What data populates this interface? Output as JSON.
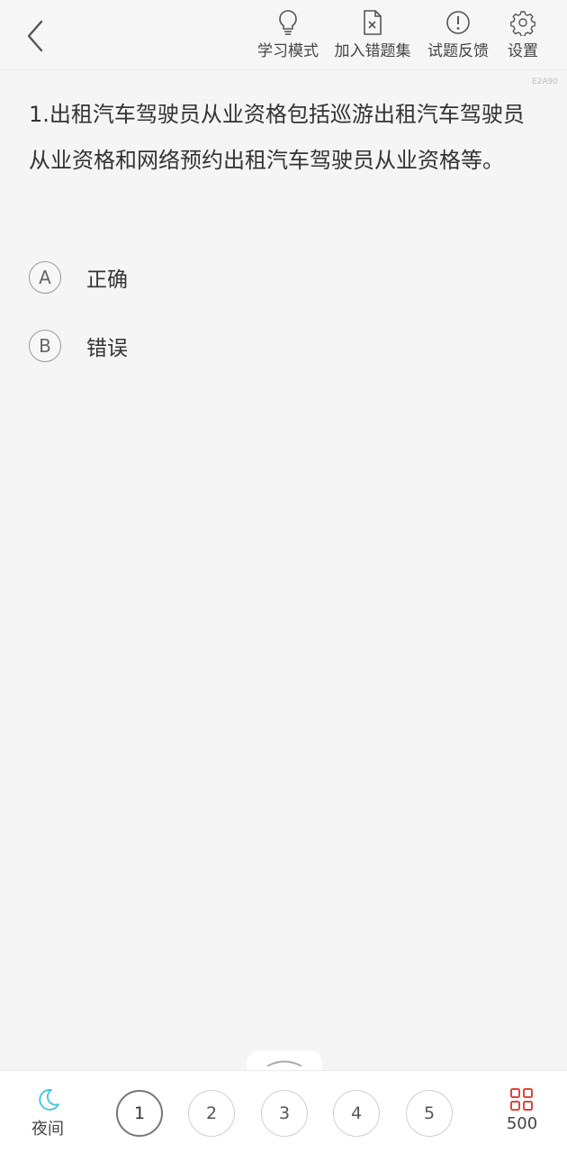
{
  "header": {
    "study_mode": "学习模式",
    "add_wrong": "加入错题集",
    "feedback": "试题反馈",
    "settings": "设置"
  },
  "code_tag": "E2A90",
  "question": {
    "text": "1.出租汽车驾驶员从业资格包括巡游出租汽车驾驶员从业资格和网络预约出租汽车驾驶员从业资格等。",
    "options": [
      {
        "letter": "A",
        "text": "正确"
      },
      {
        "letter": "B",
        "text": "错误"
      }
    ]
  },
  "bottom": {
    "night_label": "夜间",
    "numbers": [
      "1",
      "2",
      "3",
      "4",
      "5"
    ],
    "active_index": 0,
    "total": "500"
  },
  "colors": {
    "night_icon": "#3ec3e0",
    "grid_icon": "#e0453a"
  }
}
